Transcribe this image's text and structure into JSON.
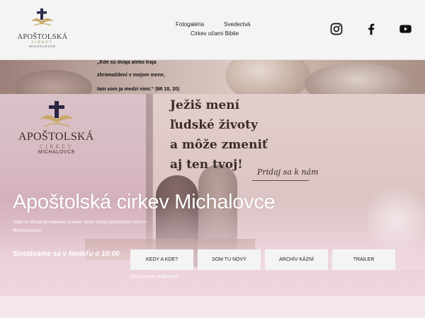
{
  "header": {
    "logo": {
      "line1": "APOŠTOLSKÁ",
      "line2": "CIRKEV",
      "line3": "MICHALOVCE"
    },
    "nav": [
      {
        "label": "Fotogaléria"
      },
      {
        "label": "Svedectvá"
      },
      {
        "label": "Cirkev očami Biblie"
      }
    ],
    "social": [
      {
        "icon": "instagram-icon"
      },
      {
        "icon": "facebook-icon"
      },
      {
        "icon": "youtube-icon"
      }
    ]
  },
  "quote": {
    "line1": "„Kde sú dvaja alebo traja",
    "line2": "zhromaždení v mojom mene,",
    "line3": "tam som ja medzi nimi.“ (Mt 18, 20)"
  },
  "hero": {
    "emblem": {
      "line1": "APOŠTOLSKÁ",
      "line2": "CIRKEV",
      "line3": "MICHALOVCE"
    },
    "sign": [
      "Ježiš mení",
      "ľudské životy",
      "a môže zmeniť",
      "aj ten tvoj!"
    ],
    "join_text": "Pridaj sa k nám",
    "title": "Apoštolská cirkev Michalovce",
    "subtitle": "Vitaj na oficiálnej webovej stránke zboru našej Apoštolskej cirkvi v Michalovciach",
    "meeting": "Stretávame sa v Nedeľu o 10:00",
    "buttons": [
      {
        "label": "KEDY A KDE?"
      },
      {
        "label": "SOM TU NOVÝ"
      },
      {
        "label": "ARCHÍV KÁZNÍ"
      },
      {
        "label": "TRAILER"
      }
    ],
    "hint": "klikaj na biele obdĺžničky!"
  },
  "colors": {
    "header_bg": "#f4f4f4",
    "hero_pink": "#d8b9c2",
    "button_bg": "#f4f4f4",
    "text_white": "#ffffff"
  }
}
